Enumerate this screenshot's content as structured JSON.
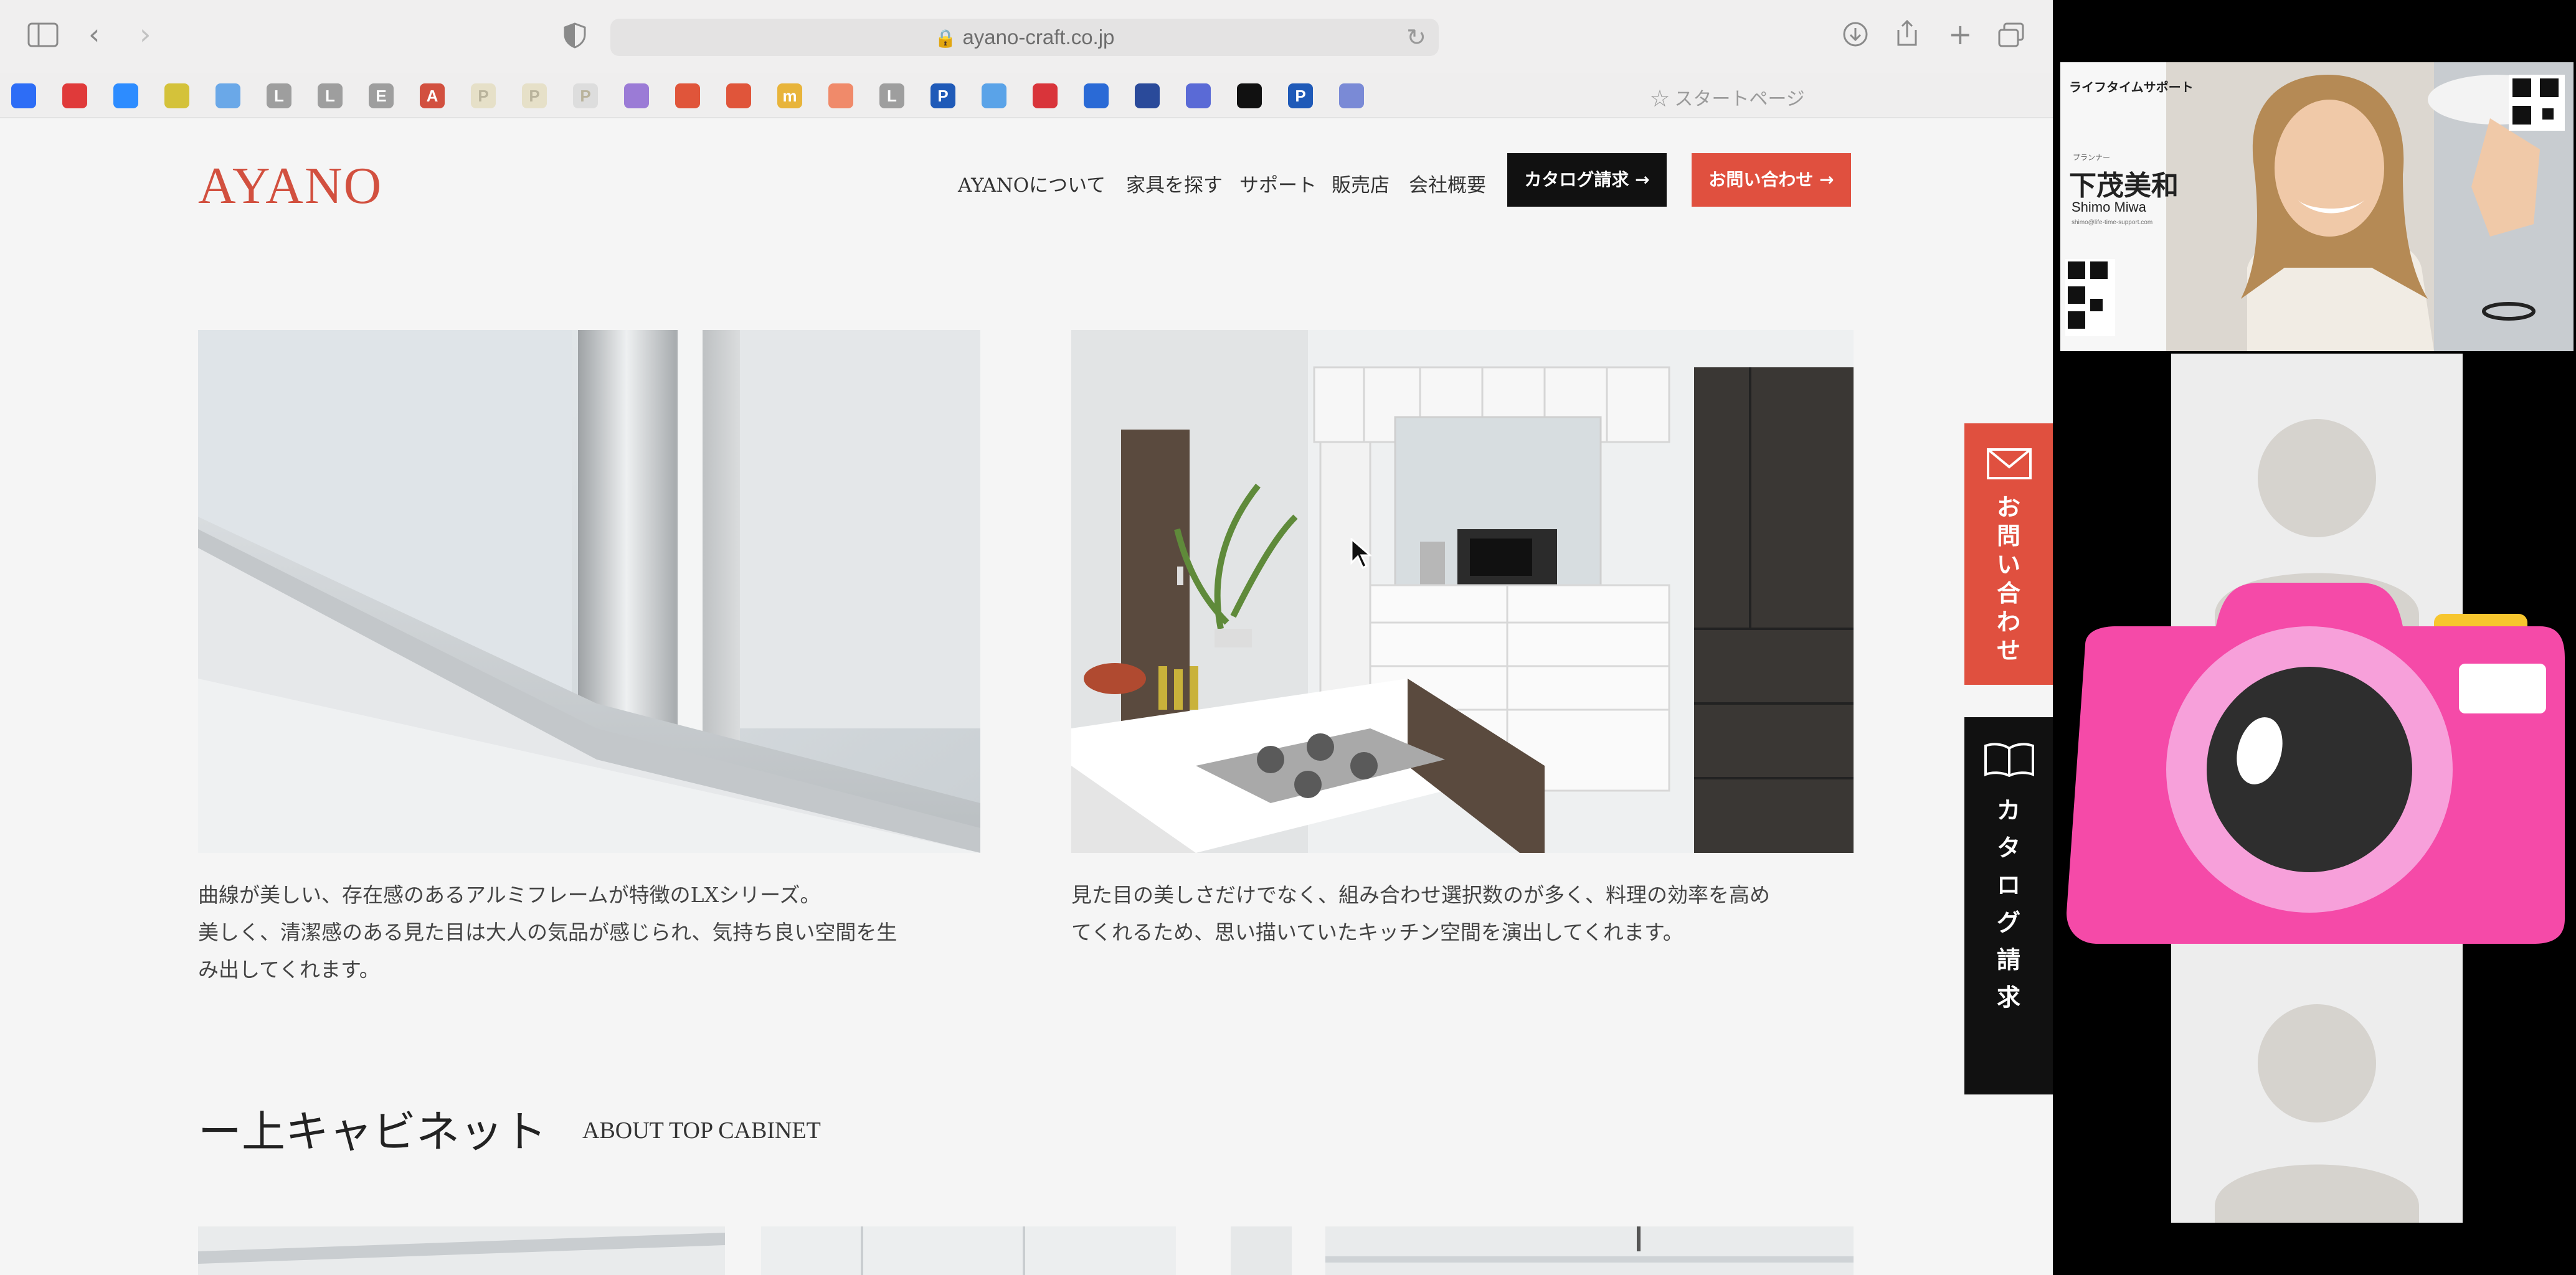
{
  "browser": {
    "url": "ayano-craft.co.jp",
    "start_page_label": "スタートページ",
    "favorites": [
      {
        "letter": "",
        "color": "#2d6df6"
      },
      {
        "letter": "",
        "color": "#e03a3a"
      },
      {
        "letter": "",
        "color": "#2d8cff"
      },
      {
        "letter": "",
        "color": "#d4c23a"
      },
      {
        "letter": "",
        "color": "#6aa8e8"
      },
      {
        "letter": "L",
        "color": "#9e9e9e"
      },
      {
        "letter": "L",
        "color": "#9e9e9e"
      },
      {
        "letter": "E",
        "color": "#9e9e9e"
      },
      {
        "letter": "A",
        "color": "#d2503f"
      },
      {
        "letter": "P",
        "color": "#e6e0c8"
      },
      {
        "letter": "P",
        "color": "#e6e0c8"
      },
      {
        "letter": "P",
        "color": "#ddd"
      },
      {
        "letter": "",
        "color": "#9b7bd6"
      },
      {
        "letter": "",
        "color": "#e0553a"
      },
      {
        "letter": "",
        "color": "#e0553a"
      },
      {
        "letter": "m",
        "color": "#e8b43a"
      },
      {
        "letter": "",
        "color": "#f08a6a"
      },
      {
        "letter": "L",
        "color": "#9e9e9e"
      },
      {
        "letter": "P",
        "color": "#1f5ab8"
      },
      {
        "letter": "",
        "color": "#5aa3e8"
      },
      {
        "letter": "",
        "color": "#d9343a"
      },
      {
        "letter": "",
        "color": "#2a6ad6"
      },
      {
        "letter": "",
        "color": "#2a4a9a"
      },
      {
        "letter": "",
        "color": "#5a6ad6"
      },
      {
        "letter": "",
        "color": "#111111"
      },
      {
        "letter": "P",
        "color": "#1f5ab8"
      },
      {
        "letter": "",
        "color": "#7a8ad6"
      }
    ]
  },
  "site": {
    "logo": "AYANO",
    "nav": [
      "AYANOについて",
      "家具を探す",
      "サポート",
      "販売店",
      "会社概要"
    ],
    "btn_catalog": "カタログ請求 →",
    "btn_contact": "お問い合わせ →",
    "caption_left": [
      "曲線が美しい、存在感のあるアルミフレームが特徴のLXシリーズ。",
      "美しく、清潔感のある見た目は大人の気品が感じられ、気持ち良い空間を生",
      "み出してくれます。"
    ],
    "caption_right": [
      "見た目の美しさだけでなく、組み合わせ選択数のが多く、料理の効率を高め",
      "てくれるため、思い描いていたキッチン空間を演出してくれます。"
    ],
    "section_title": "ー上キャビネット",
    "section_subtitle": "ABOUT TOP CABINET",
    "side_contact": [
      "お",
      "問",
      "い",
      "合",
      "わ",
      "せ"
    ],
    "side_catalog": [
      "カ",
      "タ",
      "ロ",
      "グ",
      "請",
      "求"
    ]
  },
  "video_call": {
    "main_tile_header": "ライフタイムサポート",
    "main_tile_role": "プランナー",
    "main_tile_name_jp": "下茂美和",
    "main_tile_name_en": "Shimo Miwa",
    "main_tile_email": "shimo@life-time-support.com",
    "sticker_colors": {
      "body": "#f54aa8",
      "lens_ring": "#f7a0da",
      "lens": "#2e2e2e",
      "flash": "#f7c62e"
    }
  }
}
